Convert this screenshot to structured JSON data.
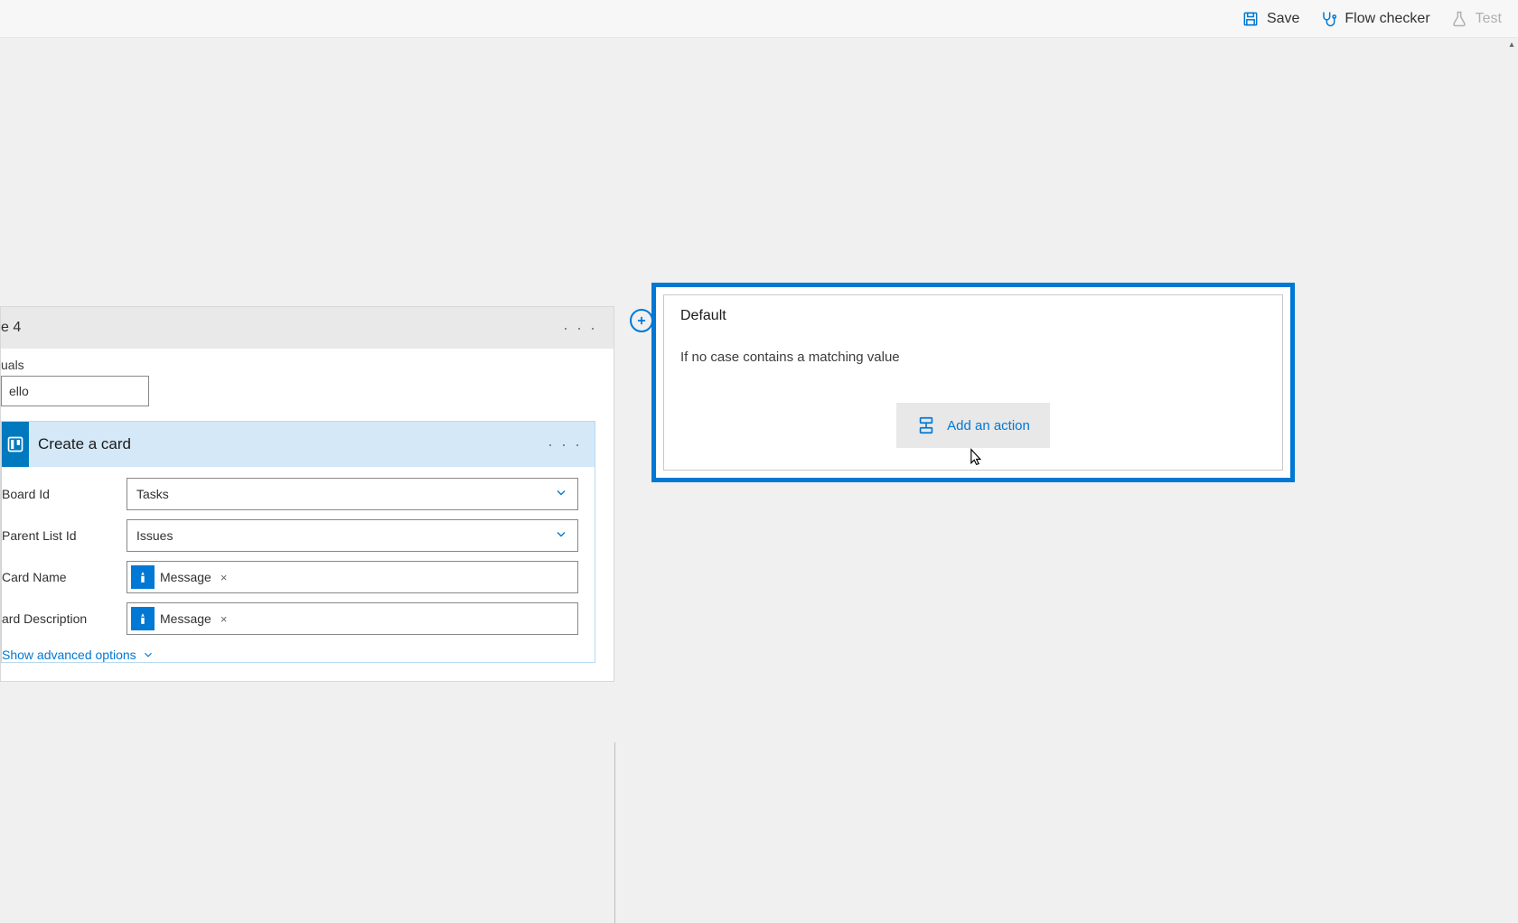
{
  "toolbar": {
    "save_label": "Save",
    "flow_checker_label": "Flow checker",
    "test_label": "Test"
  },
  "case": {
    "header_fragment": "e 4",
    "equals_label_fragment": "uals",
    "equals_value_fragment": "ello"
  },
  "action": {
    "title": "Create a card",
    "fields": {
      "board_id": {
        "label": "Board Id",
        "value": "Tasks"
      },
      "parent_list_id": {
        "label": "Parent List Id",
        "value": "Issues"
      },
      "card_name": {
        "label": "Card Name",
        "token": "Message"
      },
      "card_description": {
        "label_fragment": "ard Description",
        "token": "Message"
      }
    },
    "advanced_link": "Show advanced options"
  },
  "default_branch": {
    "title": "Default",
    "description": "If no case contains a matching value",
    "add_action_label": "Add an action"
  }
}
